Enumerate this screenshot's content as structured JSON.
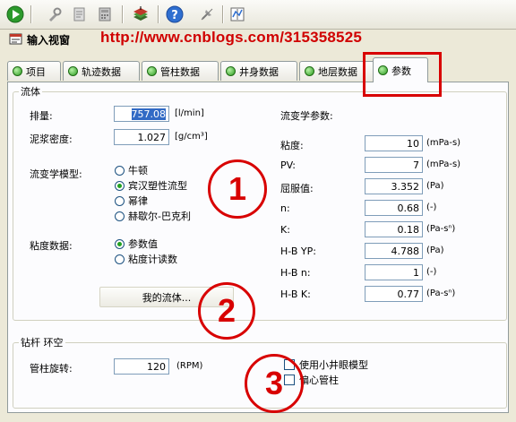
{
  "toolbar": {
    "icons": [
      "play-icon",
      "tool-icon",
      "form-icon",
      "calc-icon",
      "stack-icon",
      "help-icon",
      "pin-icon",
      "chart-icon"
    ]
  },
  "window": {
    "title": "输入视窗"
  },
  "watermark": "http://www.cnblogs.com/315358525",
  "tabs": [
    {
      "label": "项目"
    },
    {
      "label": "轨迹数据"
    },
    {
      "label": "管柱数据"
    },
    {
      "label": "井身数据"
    },
    {
      "label": "地层数据"
    },
    {
      "label": "参数",
      "active": true
    }
  ],
  "fluid": {
    "group_title": "流体",
    "flow_rate": {
      "label": "排量:",
      "value": "757.08",
      "unit": "[l/min]"
    },
    "mud_density": {
      "label": "泥浆密度:",
      "value": "1.027",
      "unit": "[g/cm³]"
    },
    "rheology_model": {
      "label": "流变学模型:",
      "options": [
        "牛顿",
        "宾汉塑性流型",
        "幂律",
        "赫歇尔-巴克利"
      ],
      "selected_index": 1
    },
    "viscosity_data": {
      "label": "粘度数据:",
      "options": [
        "参数值",
        "粘度计读数"
      ],
      "selected_index": 0
    },
    "my_fluid_button": "我的流体...",
    "rheology_params": {
      "title": "流变学参数:",
      "rows": [
        {
          "label": "粘度:",
          "value": "10",
          "unit": "(mPa-s)"
        },
        {
          "label": "PV:",
          "value": "7",
          "unit": "(mPa-s)"
        },
        {
          "label": "屈服值:",
          "value": "3.352",
          "unit": "(Pa)"
        },
        {
          "label": "n:",
          "value": "0.68",
          "unit": "(-)"
        },
        {
          "label": "K:",
          "value": "0.18",
          "unit": "(Pa-sⁿ)"
        },
        {
          "label": "H-B YP:",
          "value": "4.788",
          "unit": "(Pa)"
        },
        {
          "label": "H-B n:",
          "value": "1",
          "unit": "(-)"
        },
        {
          "label": "H-B K:",
          "value": "0.77",
          "unit": "(Pa-sⁿ)"
        }
      ]
    }
  },
  "annulus": {
    "group_title": "钻杆 环空",
    "rotation": {
      "label": "管柱旋转:",
      "value": "120",
      "unit": "(RPM)"
    },
    "checkboxes": [
      {
        "label": "使用小井眼模型",
        "checked": false
      },
      {
        "label": "偏心管柱",
        "checked": false
      }
    ]
  },
  "annotations": [
    "1",
    "2",
    "3"
  ],
  "colors": {
    "annotation": "#d80000",
    "tab_icon": "#2a9a20",
    "selection": "#316ac5"
  }
}
